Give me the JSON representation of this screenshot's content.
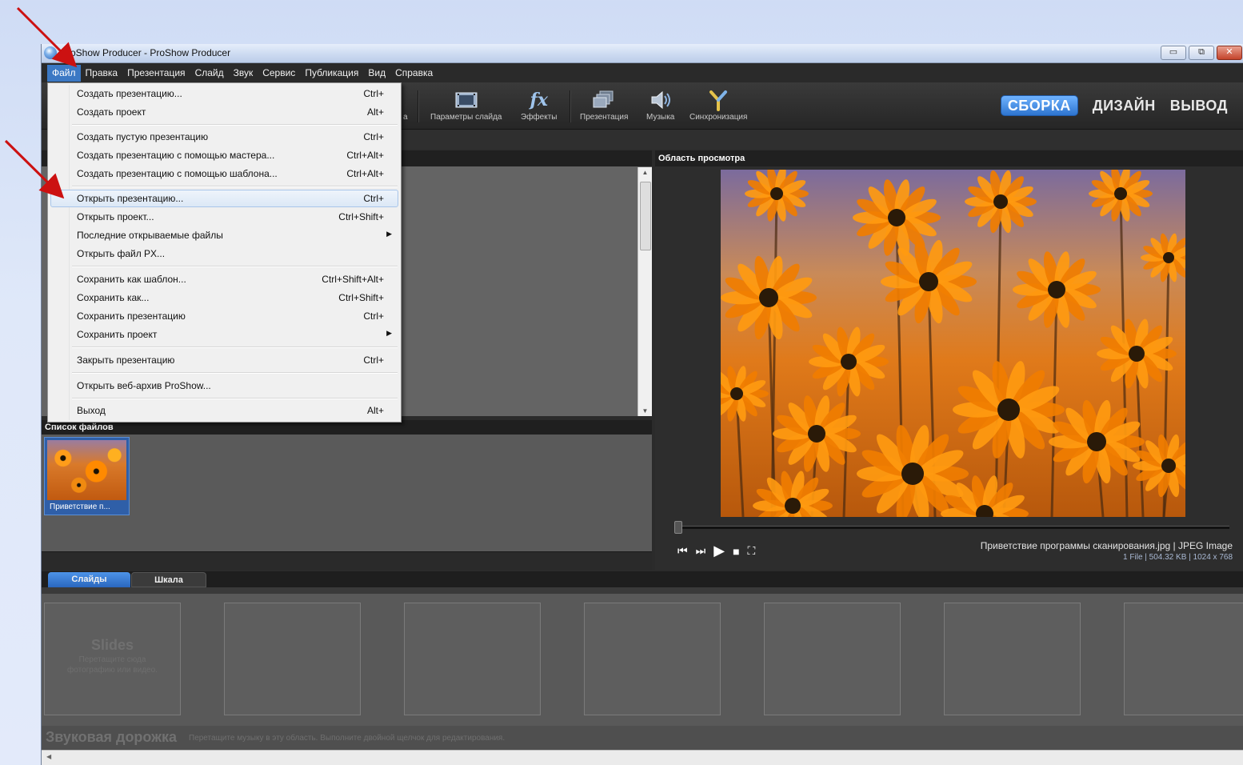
{
  "window": {
    "title": "ProShow Producer - ProShow Producer",
    "buttons": [
      "▭",
      "⧉",
      "✕"
    ]
  },
  "menubar": [
    "Файл",
    "Правка",
    "Презентация",
    "Слайд",
    "Звук",
    "Сервис",
    "Публикация",
    "Вид",
    "Справка"
  ],
  "toolbar": {
    "partial_label": "а",
    "items": [
      {
        "label": "Параметры слайда",
        "icon": "slide-options-icon"
      },
      {
        "label": "Эффекты",
        "icon": "fx-icon"
      },
      {
        "label": "Презентация",
        "icon": "presentation-icon"
      },
      {
        "label": "Музыка",
        "icon": "speaker-icon"
      },
      {
        "label": "Синхронизация",
        "icon": "sync-icon"
      }
    ],
    "modes": [
      "СБОРКА",
      "ДИЗАЙН",
      "ВЫВОД"
    ]
  },
  "file_menu": {
    "items": [
      {
        "label": "Создать презентацию...",
        "shortcut": "Ctrl+"
      },
      {
        "label": "Создать проект",
        "shortcut": "Alt+"
      },
      {
        "label": "Создать пустую презентацию",
        "shortcut": "Ctrl+"
      },
      {
        "label": "Создать презентацию с помощью мастера...",
        "shortcut": "Ctrl+Alt+"
      },
      {
        "label": "Создать презентацию с помощью шаблона...",
        "shortcut": "Ctrl+Alt+"
      },
      {
        "label": "Открыть презентацию...",
        "shortcut": "Ctrl+"
      },
      {
        "label": "Открыть проект...",
        "shortcut": "Ctrl+Shift+"
      },
      {
        "label": "Последние открываемые файлы",
        "shortcut": ""
      },
      {
        "label": "Открыть файл PX...",
        "shortcut": ""
      },
      {
        "label": "Сохранить как шаблон...",
        "shortcut": "Ctrl+Shift+Alt+"
      },
      {
        "label": "Сохранить как...",
        "shortcut": "Ctrl+Shift+"
      },
      {
        "label": "Сохранить презентацию",
        "shortcut": "Ctrl+"
      },
      {
        "label": "Сохранить проект",
        "shortcut": ""
      },
      {
        "label": "Закрыть презентацию",
        "shortcut": "Ctrl+"
      },
      {
        "label": "Открыть веб-архив ProShow...",
        "shortcut": ""
      },
      {
        "label": "Выход",
        "shortcut": "Alt+"
      }
    ]
  },
  "file_list": {
    "header": "Список файлов",
    "items": [
      {
        "label": "Приветствие п..."
      }
    ]
  },
  "preview": {
    "header": "Область просмотра",
    "file_name": "Приветствие программы сканирования.jpg  |  JPEG Image",
    "file_meta": "1 File  |  504.32 KB  |  1024 x 768"
  },
  "timeline": {
    "tabs": [
      "Слайды",
      "Шкала"
    ],
    "slides_title": "Slides",
    "slides_hint_1": "Перетащите сюда",
    "slides_hint_2": "фотографию или видео.",
    "soundtrack_title": "Звуковая дорожка",
    "soundtrack_hint": "Перетащите музыку в эту область. Выполните двойной щелчок для редактирования."
  },
  "colors": {
    "accent": "#3b78c4",
    "annotation_arrow": "#cc1111"
  }
}
